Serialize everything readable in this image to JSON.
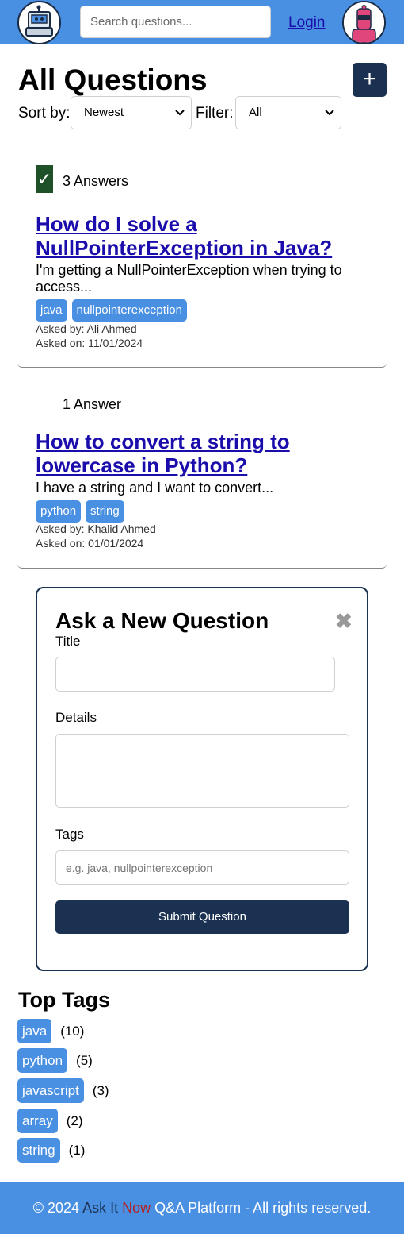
{
  "header": {
    "search_placeholder": "Search questions...",
    "login_label": "Login"
  },
  "page": {
    "title": "All Questions",
    "add_label": "+",
    "sort_label": "Sort by:",
    "sort_value": "Newest",
    "filter_label": "Filter:",
    "filter_value": "All"
  },
  "questions": [
    {
      "answered": true,
      "answers": "3 Answers",
      "title": "How do I solve a NullPointerException in Java?",
      "excerpt": "I'm getting a NullPointerException when trying to access...",
      "tags": [
        "java",
        "nullpointerexception"
      ],
      "asked_by": "Asked by: Ali Ahmed",
      "asked_on": "Asked on: 11/01/2024"
    },
    {
      "answered": false,
      "answers": "1 Answer",
      "title": "How to convert a string to lowercase in Python?",
      "excerpt": "I have a string and I want to convert...",
      "tags": [
        "python",
        "string"
      ],
      "asked_by": "Asked by: Khalid Ahmed",
      "asked_on": "Asked on: 01/01/2024"
    }
  ],
  "ask_form": {
    "title": "Ask a New Question",
    "close_label": "✖",
    "title_label": "Title",
    "details_label": "Details",
    "tags_label": "Tags",
    "tags_placeholder": "e.g. java, nullpointerexception",
    "submit_label": "Submit Question"
  },
  "top_tags": {
    "title": "Top Tags",
    "items": [
      {
        "tag": "java",
        "count": "(10)"
      },
      {
        "tag": "python",
        "count": "(5)"
      },
      {
        "tag": "javascript",
        "count": "(3)"
      },
      {
        "tag": "array",
        "count": "(2)"
      },
      {
        "tag": "string",
        "count": "(1)"
      }
    ]
  },
  "footer": {
    "prefix": "© 2024 ",
    "brand_1": "Ask It ",
    "brand_2": "Now",
    "suffix": " Q&A Platform - All rights reserved."
  },
  "colors": {
    "header": "#4a90e2",
    "primary_dark": "#1b3152",
    "tag": "#4a90e2",
    "check": "#1f5128",
    "link": "#1a0dab"
  }
}
